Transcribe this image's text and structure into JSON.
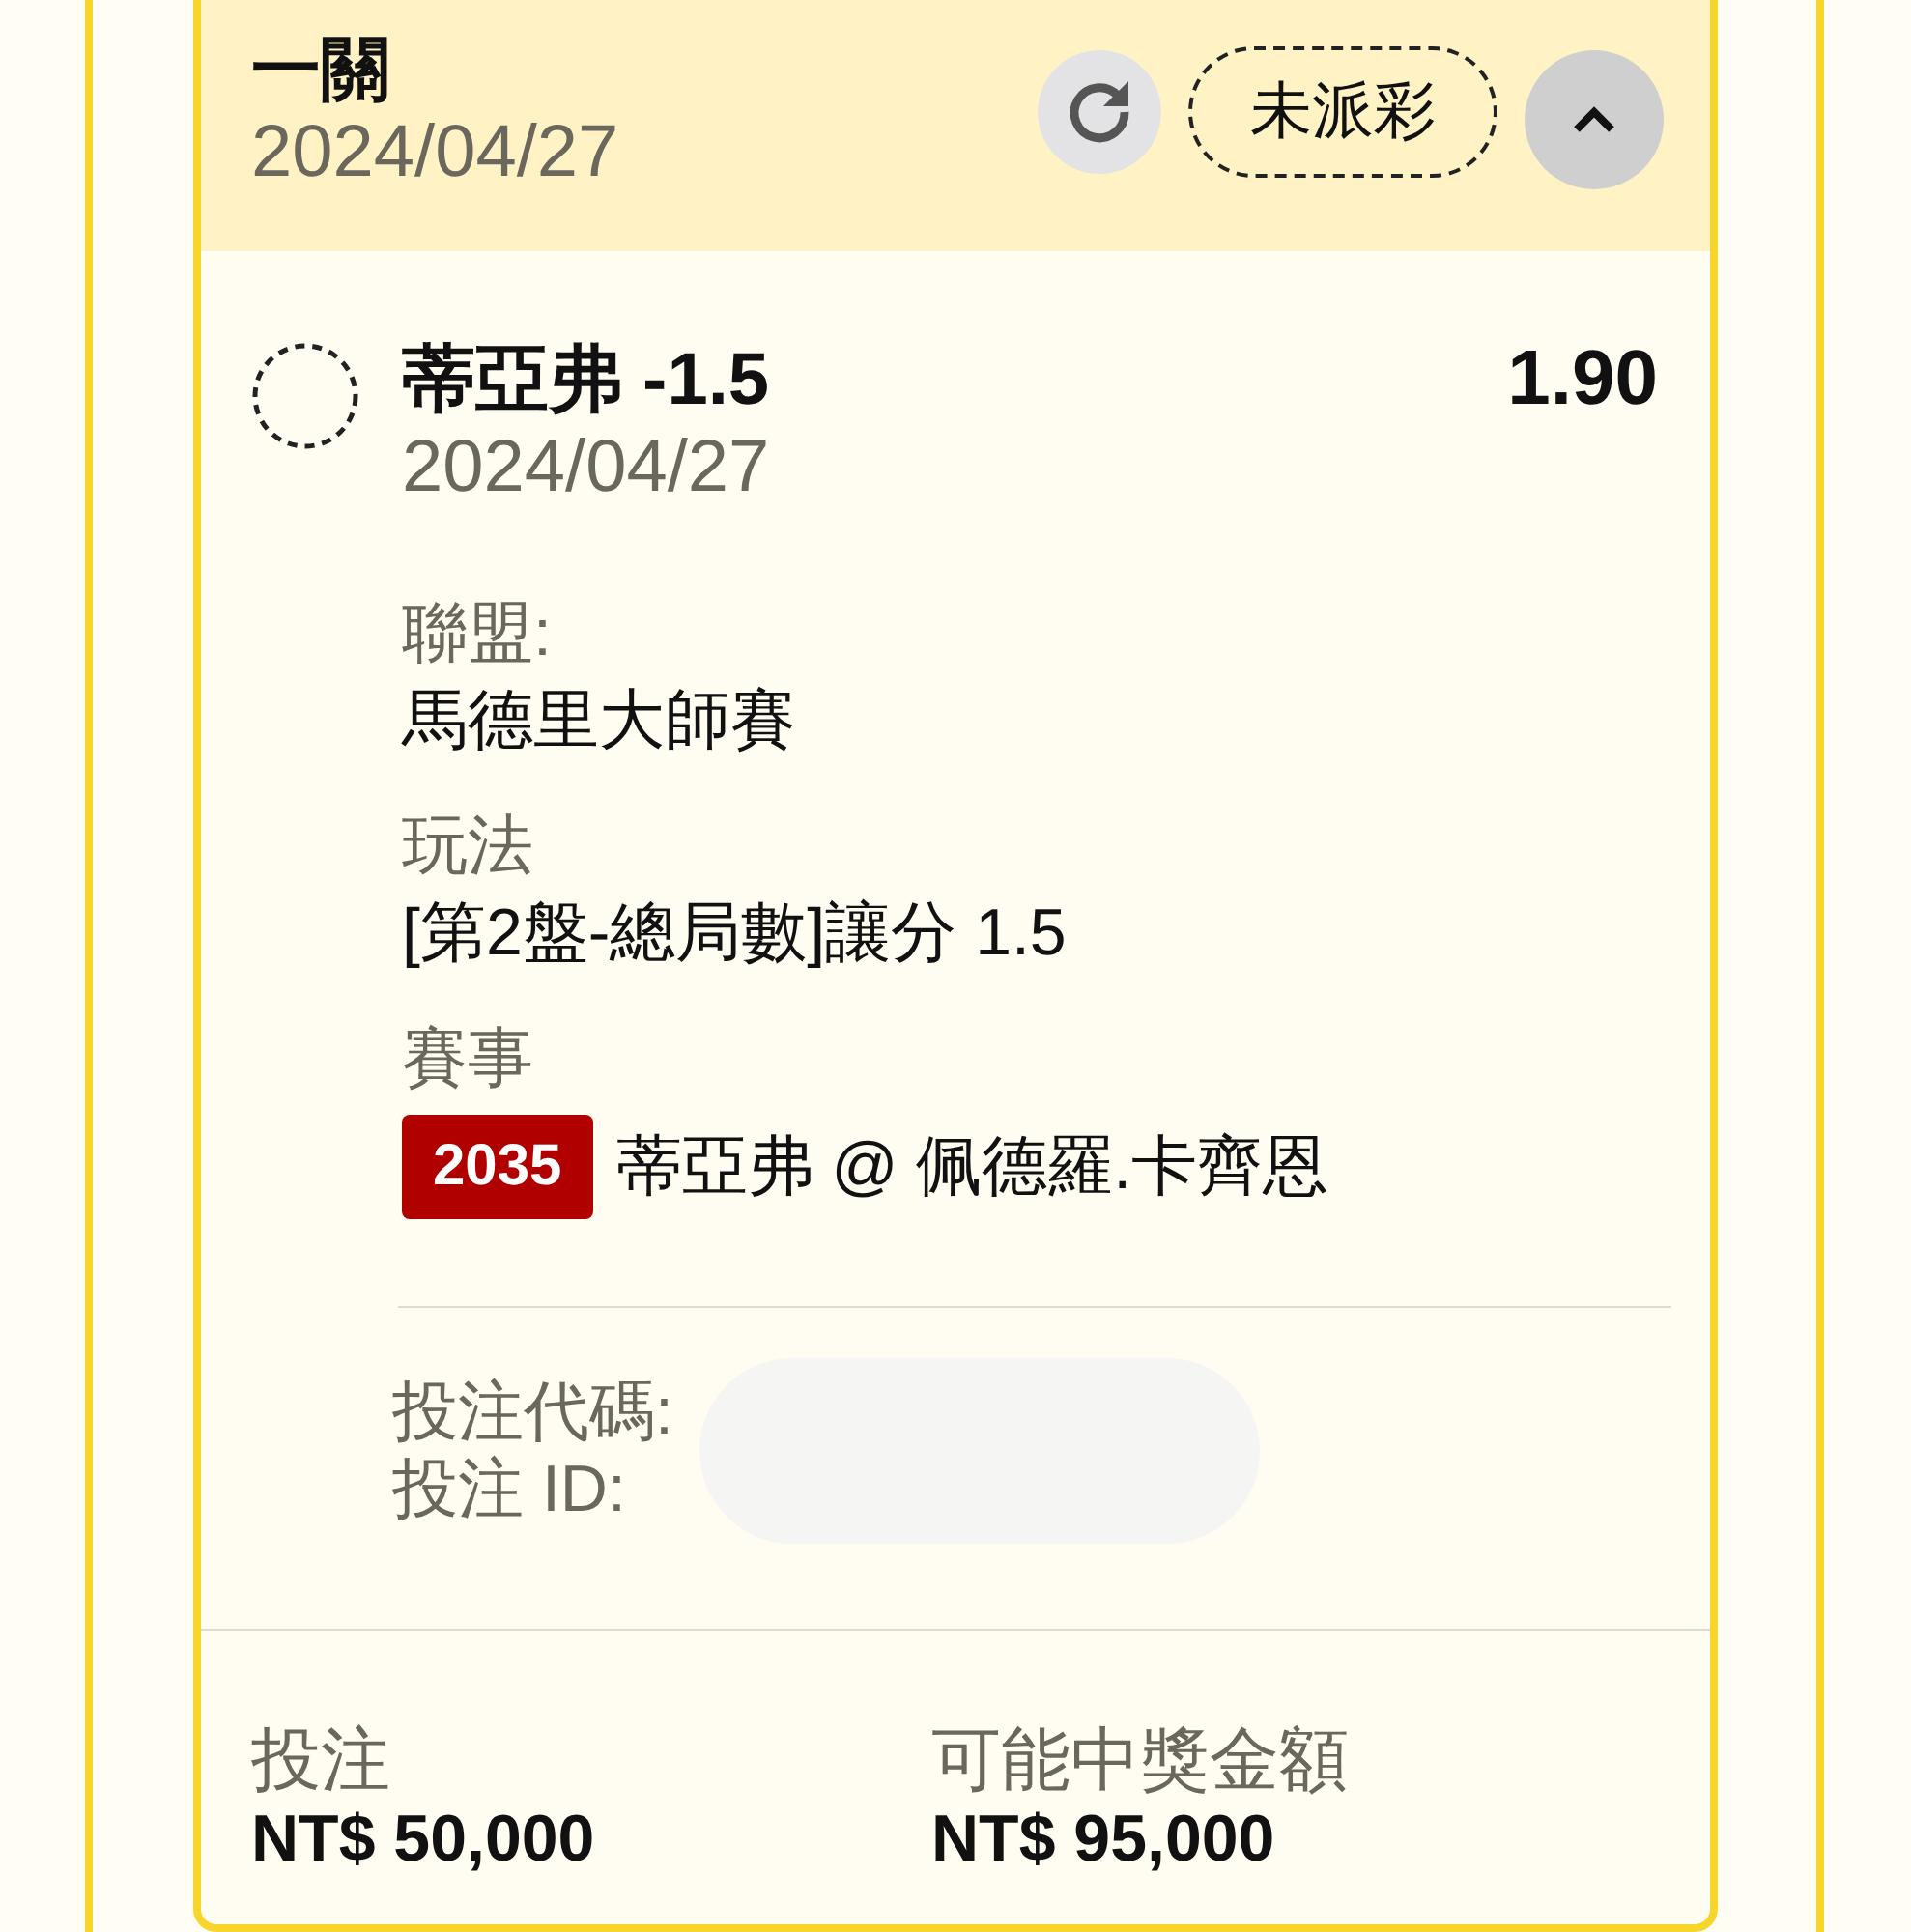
{
  "header": {
    "title": "一關",
    "date": "2024/04/27",
    "status": "未派彩",
    "expanded": true
  },
  "selections": [
    {
      "settled": false,
      "name": "蒂亞弗 -1.5",
      "date": "2024/04/27",
      "odds": "1.90",
      "details": [
        {
          "label": "聯盟:",
          "value": "馬德里大師賽"
        },
        {
          "label": "玩法",
          "value": "[第2盤-總局數]讓分 1.5"
        },
        {
          "label": "賽事",
          "badge": "2035",
          "value": "蒂亞弗 @ 佩德羅.卡齊恩"
        }
      ]
    }
  ],
  "bet_codes": {
    "labels": [
      "投注代碼:",
      "投注 ID:"
    ],
    "redacted": true
  },
  "summary": [
    {
      "label": "投注",
      "amount": "NT$ 50,000"
    },
    {
      "label": "可能中獎金額",
      "amount": "NT$ 95,000"
    }
  ]
}
